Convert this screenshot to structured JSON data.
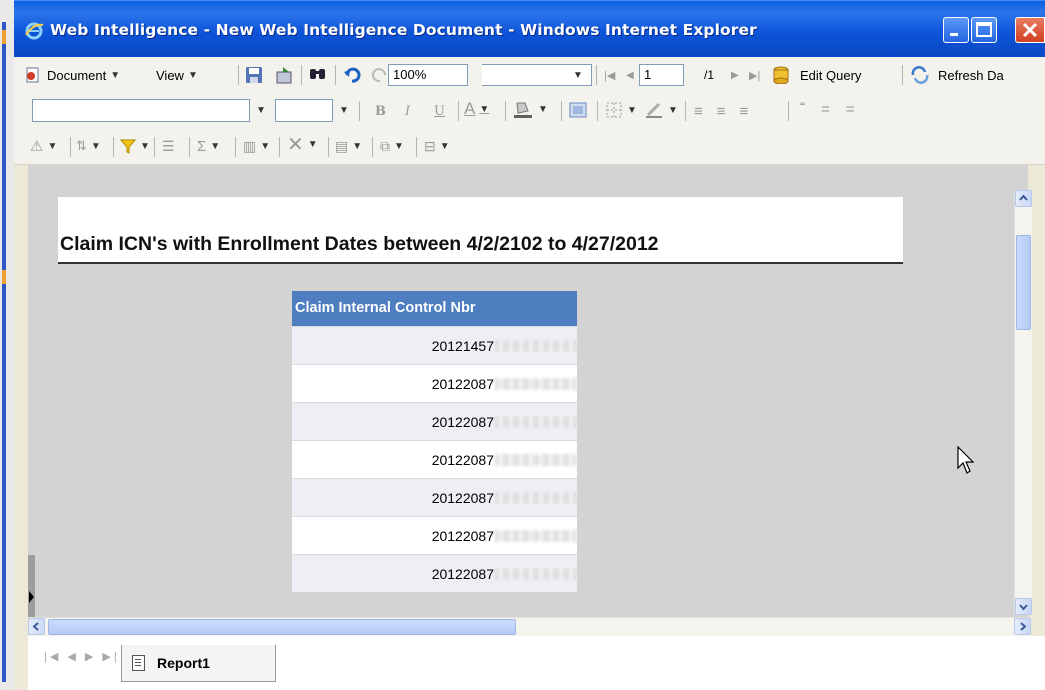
{
  "window": {
    "title": "Web Intelligence - New Web Intelligence Document - Windows Internet Explorer"
  },
  "toolbar_main": {
    "document_label": "Document",
    "view_label": "View",
    "zoom_value": "100%",
    "page_value": "1",
    "page_total": "/1",
    "edit_query_label": "Edit Query",
    "refresh_label": "Refresh Da"
  },
  "report": {
    "title": "Claim ICN's with Enrollment Dates between 4/2/2102 to 4/27/2012",
    "column_header": "Claim Internal Control Nbr",
    "rows": [
      "20121457",
      "20122087",
      "20122087",
      "20122087",
      "20122087",
      "20122087",
      "20122087"
    ]
  },
  "tabs": {
    "report_tab": "Report1"
  },
  "colors": {
    "titlebar": "#0a5fe0",
    "header_blue": "#4f7ec0",
    "report_bg": "#d3d3d3"
  },
  "icons": [
    "ie-logo-icon",
    "minimize-icon",
    "maximize-icon",
    "close-icon",
    "document-icon",
    "save-icon",
    "find-icon",
    "undo-icon",
    "redo-icon",
    "edit-query-icon",
    "refresh-icon",
    "bold-icon",
    "italic-icon",
    "underline-icon",
    "font-color-icon",
    "fill-color-icon",
    "align-left-icon",
    "align-center-icon",
    "align-right-icon",
    "alert-icon",
    "sort-icon",
    "filter-icon",
    "sum-icon",
    "mouse-pointer-icon"
  ]
}
